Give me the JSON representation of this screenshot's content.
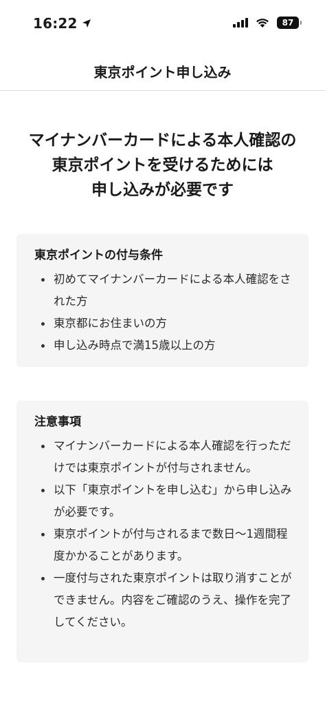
{
  "status_bar": {
    "time": "16:22",
    "battery": "87"
  },
  "header": {
    "title": "東京ポイント申し込み"
  },
  "main": {
    "heading_lines": [
      "マイナンバーカードによる本人確認の",
      "東京ポイントを受けるためには",
      "申し込みが必要です"
    ],
    "conditions": {
      "title": "東京ポイントの付与条件",
      "items": [
        "初めてマイナンバーカードによる本人確認をされた方",
        "東京都にお住まいの方",
        "申し込み時点で満15歳以上の方"
      ]
    },
    "notes": {
      "title": "注意事項",
      "items": [
        "マイナンバーカードによる本人確認を行っただけでは東京ポイントが付与されません。",
        "以下「東京ポイントを申し込む」から申し込みが必要です。",
        "東京ポイントが付与されるまで数日〜1週間程度かかることがあります。",
        "一度付与された東京ポイントは取り消すことができません。内容をご確認のうえ、操作を完了してください。"
      ]
    }
  },
  "icons": {
    "location": "location-arrow-icon",
    "signal": "cellular-signal-icon",
    "wifi": "wifi-icon",
    "battery": "battery-icon"
  }
}
